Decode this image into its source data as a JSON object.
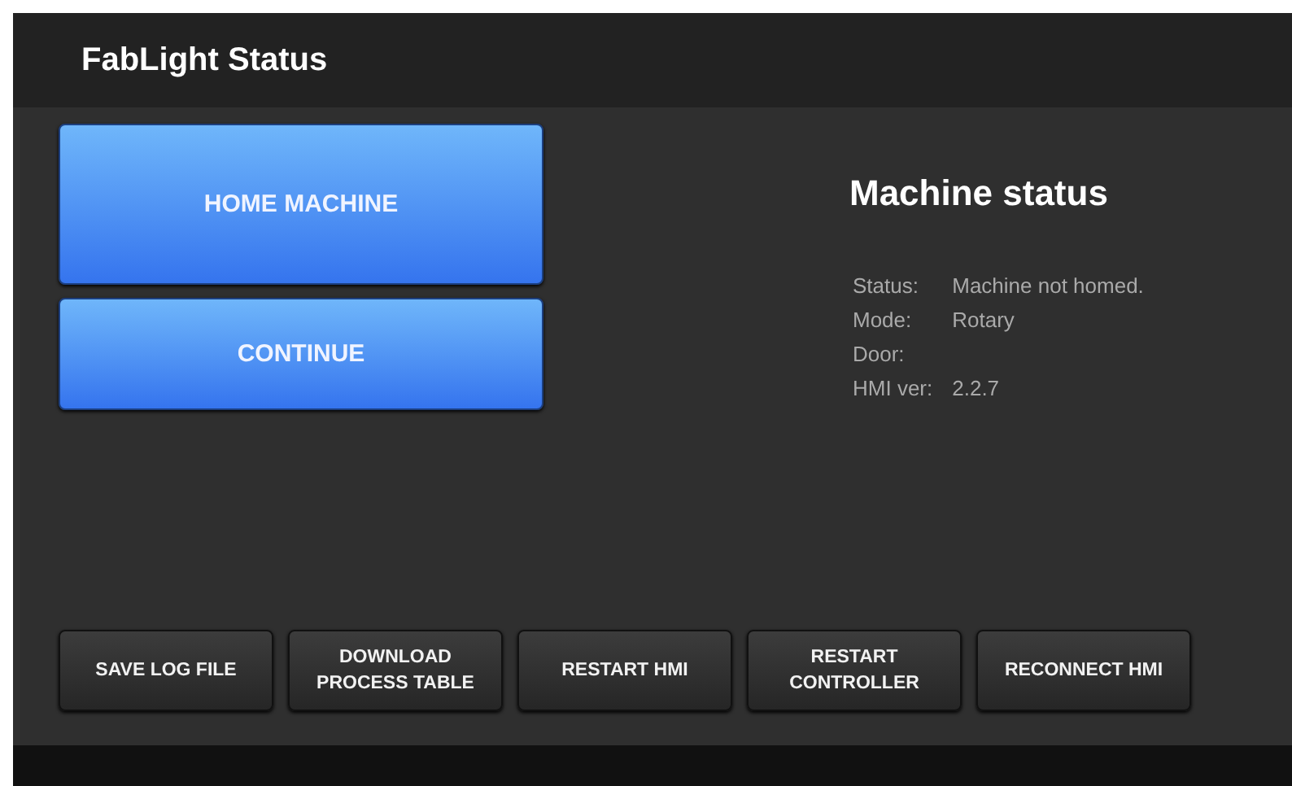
{
  "header": {
    "title": "FabLight Status"
  },
  "actions": [
    "HOME MACHINE",
    "CONTINUE"
  ],
  "machine_status": {
    "title": "Machine status",
    "fields": [
      {
        "label": "Status:",
        "value": "Machine not homed."
      },
      {
        "label": "Mode:",
        "value": "Rotary"
      },
      {
        "label": "Door:"
      },
      {
        "label": "HMI ver:",
        "value": "2.2.7"
      }
    ]
  },
  "toolbar": [
    "SAVE LOG FILE",
    "DOWNLOAD PROCESS TABLE",
    "RESTART HMI",
    "RESTART CONTROLLER",
    "RECONNECT HMI"
  ]
}
